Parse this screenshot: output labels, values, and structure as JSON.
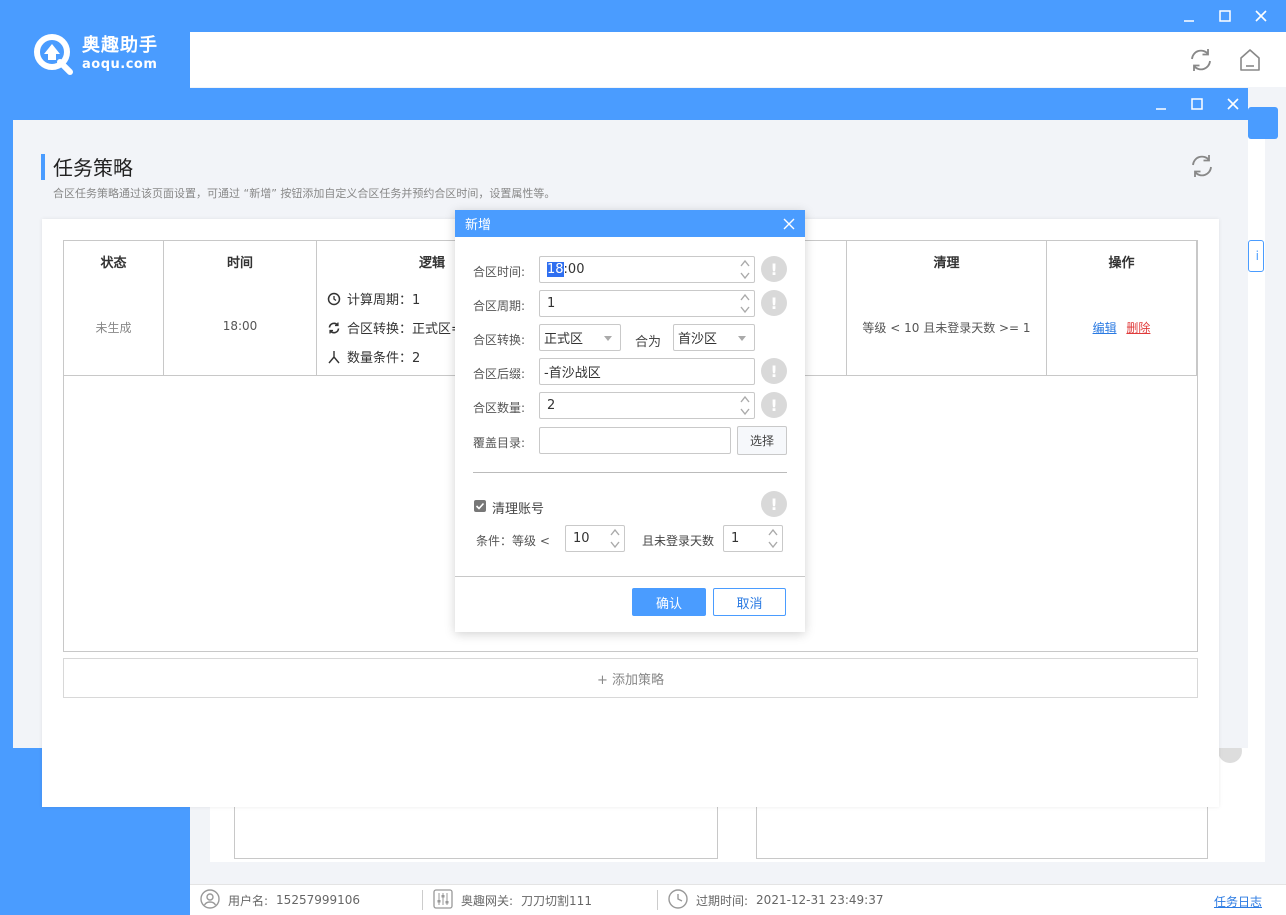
{
  "app": {
    "logo_name": "奥趣助手",
    "logo_domain": "aoqu.com",
    "accent_color": "#4a9cff",
    "icons": [
      "minimize-icon",
      "maximize-icon",
      "close-icon",
      "refresh-icon",
      "home-icon"
    ]
  },
  "statusbar": {
    "username_label": "用户名:",
    "username": "15257999106",
    "gateway_label": "奥趣网关:",
    "gateway": "刀刀切割111",
    "expire_label": "过期时间:",
    "expire": "2021-12-31 23:49:37",
    "log_link": "任务日志"
  },
  "page": {
    "title": "任务策略",
    "description": "合区任务策略通过该页面设置，可通过 “新增” 按钮添加自定义合区任务并预约合区时间，设置属性等。"
  },
  "table": {
    "headers": {
      "status": "状态",
      "time": "时间",
      "logic": "逻辑",
      "cleanup": "清理",
      "actions": "操作"
    },
    "rows": [
      {
        "status": "未生成",
        "time": "18:00",
        "logic": {
          "period": "计算周期：1",
          "convert": "合区转换：正式区=",
          "count": "数量条件：2"
        },
        "cleanup": "等级 < 10 且未登录天数 >= 1",
        "edit": "编辑",
        "delete": "删除"
      }
    ],
    "add_label": "+ 添加策略"
  },
  "background": {
    "right_button_text": "i"
  },
  "dialog": {
    "title": "新增",
    "merge_time_label": "合区时间:",
    "merge_time_selected": "18",
    "merge_time_rest": ":00",
    "merge_period_label": "合区周期:",
    "merge_period": "1",
    "convert_label": "合区转换:",
    "convert_from": "正式区",
    "merge_as_label": "合为",
    "convert_to": "首沙区",
    "suffix_label": "合区后缀:",
    "suffix": "-首沙战区",
    "count_label": "合区数量:",
    "count": "2",
    "dir_label": "覆盖目录:",
    "dir_value": "",
    "select_button": "选择",
    "cleanup_label": "清理账号",
    "cleanup_checked": true,
    "cond_label": "条件：等级 <",
    "cond_level": "10",
    "cond_days_label": "且未登录天数",
    "cond_days": "1",
    "ok": "确认",
    "cancel": "取消",
    "info_mark": "!"
  }
}
